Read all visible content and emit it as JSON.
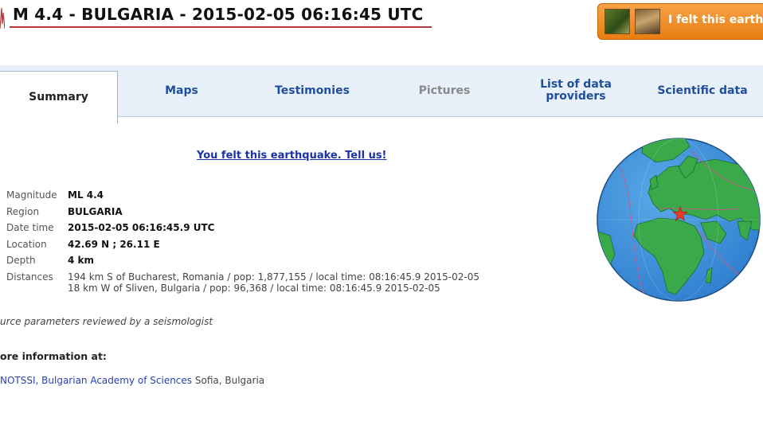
{
  "header": {
    "title": "M 4.4 - BULGARIA - 2015-02-05 06:16:45 UTC",
    "felt_button_label": "I felt this earthq"
  },
  "tabs": [
    {
      "label": "Summary",
      "active": true
    },
    {
      "label": "Maps"
    },
    {
      "label": "Testimonies"
    },
    {
      "label": "Pictures",
      "disabled": true
    },
    {
      "label": "List of data providers"
    },
    {
      "label": "Scientific data"
    }
  ],
  "tell_us_link": "You felt this earthquake. Tell us!",
  "info": {
    "magnitude": {
      "label": "Magnitude",
      "value": "ML 4.4"
    },
    "region": {
      "label": "Region",
      "value": "BULGARIA"
    },
    "datetime": {
      "label": "Date time",
      "value": "2015-02-05 06:16:45.9 UTC"
    },
    "location": {
      "label": "Location",
      "value": "42.69 N ; 26.11 E"
    },
    "depth": {
      "label": "Depth",
      "value": "4 km"
    },
    "distances": {
      "label": "Distances",
      "lines": [
        "194 km S of Bucharest, Romania / pop: 1,877,155 / local time: 08:16:45.9 2015-02-05",
        "18 km W of Sliven, Bulgaria / pop: 96,368 / local time: 08:16:45.9 2015-02-05"
      ]
    }
  },
  "reviewed_note": "urce parameters reviewed by a seismologist",
  "more_info_heading": "ore information at:",
  "source": {
    "link_text": "NOTSSI, Bulgarian Academy of Sciences",
    "location_text": "Sofia, Bulgaria"
  },
  "colors": {
    "accent_tab_text": "#1f4e9c",
    "title_underline": "#b23a3a",
    "felt_button": "#e97e12",
    "ocean": "#3b8fd6",
    "land": "#3aa94a",
    "epicenter": "#e83a2a"
  }
}
